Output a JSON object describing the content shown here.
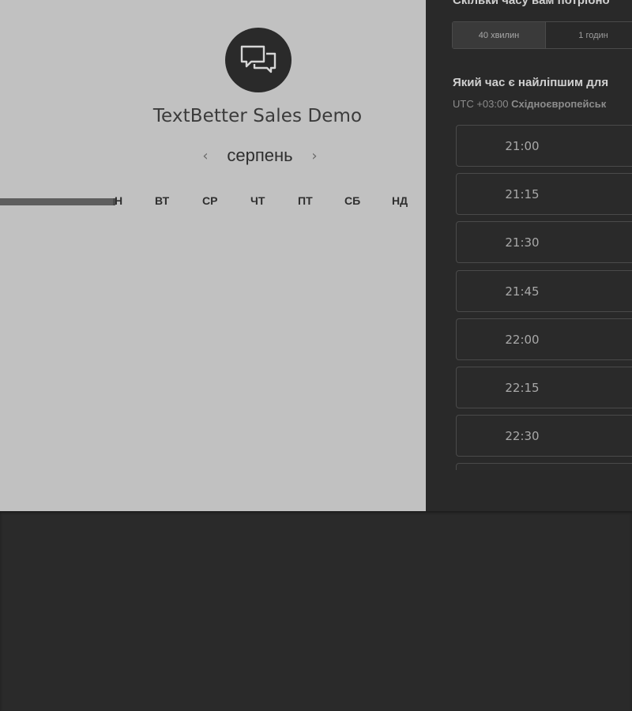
{
  "widget": {
    "title": "TextBetter Sales Demo",
    "month": "серпень",
    "nav_prev": "‹",
    "nav_next": "›",
    "weekdays": [
      "Н",
      "ВТ",
      "СР",
      "ЧТ",
      "ПТ",
      "СБ",
      "НД"
    ],
    "avatar_icon": "chat-bubbles-icon"
  },
  "booking": {
    "duration_question": "Скільки часу вам потрібно",
    "durations": [
      "40 хвилин",
      "1 годин"
    ],
    "selected_duration": "40 хвилин",
    "time_question": "Який час є найліпшим для",
    "timezone_prefix": "UTC +03:00",
    "timezone_name": "Східноєвропейськ",
    "slots": [
      "21:00",
      "21:15",
      "21:30",
      "21:45",
      "22:00",
      "22:15",
      "22:30",
      ""
    ]
  },
  "colors": {
    "left_background": "#c1c1c1",
    "dark_background": "#292929",
    "slot_border": "#4a4a4a"
  }
}
